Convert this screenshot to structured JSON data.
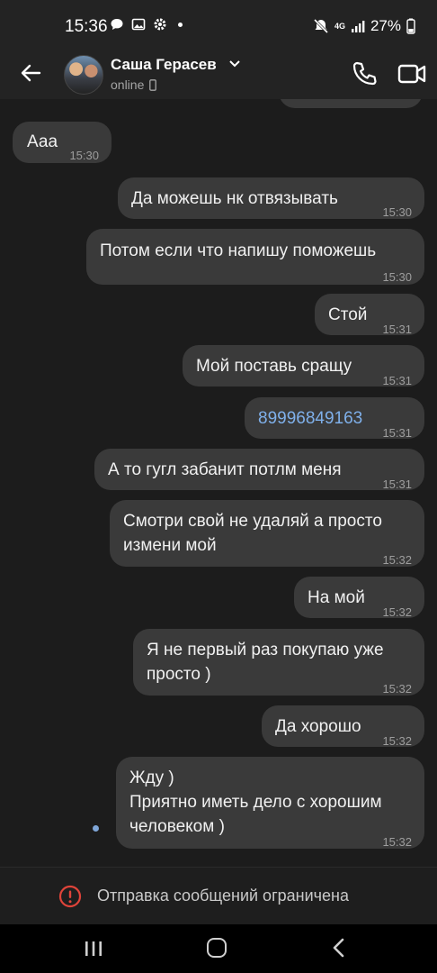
{
  "status_bar": {
    "time": "15:36",
    "signal_label": "4G",
    "battery": "27%"
  },
  "header": {
    "contact_name": "Саша Герасев",
    "presence": "online"
  },
  "messages": [
    {
      "dir": "in",
      "text": "Ааа",
      "time": "15:30"
    },
    {
      "dir": "out",
      "text": "Да можешь нк отвязывать",
      "time": "15:30"
    },
    {
      "dir": "out",
      "text": "Потом если что напишу поможешь",
      "time": "15:30"
    },
    {
      "dir": "out",
      "text": "Стой",
      "time": "15:31"
    },
    {
      "dir": "out",
      "text": "Мой поставь сращу",
      "time": "15:31"
    },
    {
      "dir": "out",
      "text": "89996849163",
      "time": "15:31",
      "is_link": true
    },
    {
      "dir": "out",
      "text": "А то гугл забанит потлм меня",
      "time": "15:31"
    },
    {
      "dir": "out",
      "text": "Смотри свой не удаляй а просто\nизмени мой",
      "time": "15:32"
    },
    {
      "dir": "out",
      "text": "На мой",
      "time": "15:32"
    },
    {
      "dir": "out",
      "text": "Я не первый раз покупаю уже\nпросто )",
      "time": "15:32"
    },
    {
      "dir": "out",
      "text": "Да хорошо",
      "time": "15:32"
    },
    {
      "dir": "out",
      "text": "Жду )\nПриятно иметь дело с хорошим\nчеловеком )",
      "time": "15:32"
    }
  ],
  "notice": {
    "text": "Отправка сообщений ограничена"
  },
  "colors": {
    "background": "#1c1c1c",
    "bubble": "#3a3a3a",
    "link": "#7fb0ea",
    "notice_icon": "#e0443a"
  }
}
